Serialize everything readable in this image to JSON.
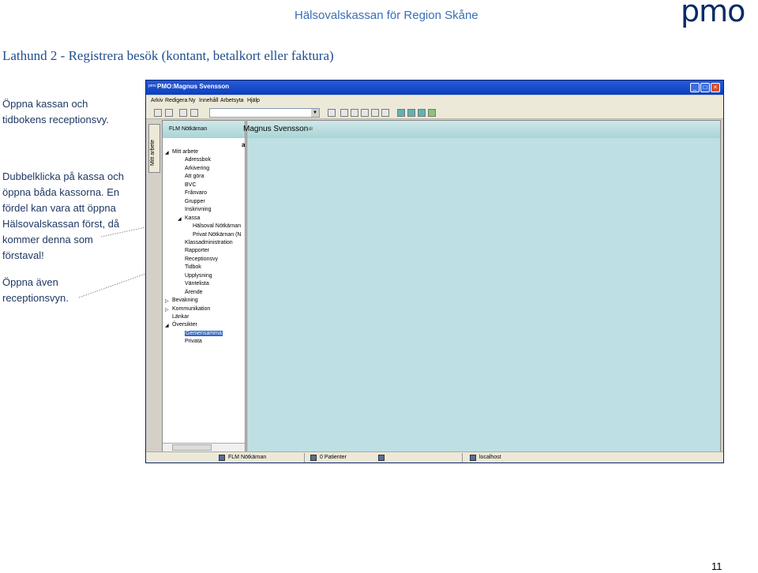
{
  "header": {
    "title": "Hälsovalskassan för Region Skåne",
    "logo_text": "pmo"
  },
  "document": {
    "title": "Lathund 2 - Registrera besök (kontant, betalkort eller faktura)",
    "notes": [
      [
        "Öppna kassan och",
        "tidbokens receptionsvy."
      ],
      [
        "Dubbelklicka på kassa och",
        "öppna båda kassorna. En",
        "fördel kan vara att öppna",
        "Hälsovalskassan först, då",
        "kommer denna som",
        "förstaval!"
      ],
      [
        "Öppna även",
        "receptionsvyn."
      ]
    ],
    "page_number": "11"
  },
  "window": {
    "title": "PMO:Magnus Svensson",
    "app_icon": "pmo",
    "menu": [
      "Arkiv",
      "Redigera",
      "Ny",
      "Innehåll",
      "Arbetsyta",
      "Hjälp"
    ],
    "vertical_tab": "Mitt arbete",
    "side_panel_title": "FLM Nötkärnan",
    "main_panel_user": "Magnus Svensson",
    "main_panel_suffix": "dr",
    "main_panel_letter": "a",
    "tree": [
      {
        "label": "Mitt arbete",
        "level": 0,
        "arrow": "◢"
      },
      {
        "label": "Adressbok",
        "level": 1
      },
      {
        "label": "Arkivering",
        "level": 1
      },
      {
        "label": "Att göra",
        "level": 1
      },
      {
        "label": "BVC",
        "level": 1
      },
      {
        "label": "Frånvaro",
        "level": 1
      },
      {
        "label": "Grupper",
        "level": 1
      },
      {
        "label": "Inskrivning",
        "level": 1
      },
      {
        "label": "Kassa",
        "level": 1,
        "arrow": "◢"
      },
      {
        "label": "Hälsoval Nötkärnan",
        "level": 2
      },
      {
        "label": "Privat Nötkärnan (N",
        "level": 2
      },
      {
        "label": "Klassadministration",
        "level": 1
      },
      {
        "label": "Rapporter",
        "level": 1
      },
      {
        "label": "Receptionsvy",
        "level": 1
      },
      {
        "label": "Tidbok",
        "level": 1
      },
      {
        "label": "Upplysning",
        "level": 1
      },
      {
        "label": "Väntelista",
        "level": 1
      },
      {
        "label": "Ärende",
        "level": 1
      },
      {
        "label": "Bevakning",
        "level": 0,
        "arrow": "▷"
      },
      {
        "label": "Kommunikation",
        "level": 0,
        "arrow": "▷"
      },
      {
        "label": "Länkar",
        "level": 0
      },
      {
        "label": "Översikter",
        "level": 0,
        "arrow": "◢"
      },
      {
        "label": "Gemensamma",
        "level": 1,
        "selected": true
      },
      {
        "label": "Privata",
        "level": 1
      }
    ],
    "status": {
      "unit": "FLM Nötkärnan",
      "patients": "0 Patienter",
      "server": "localhost"
    }
  },
  "colors": {
    "heading": "#1f4e8f",
    "header": "#3a6fb5",
    "logo": "#0b2a66",
    "note": "#1f3864",
    "panel": "#bedfe3"
  }
}
